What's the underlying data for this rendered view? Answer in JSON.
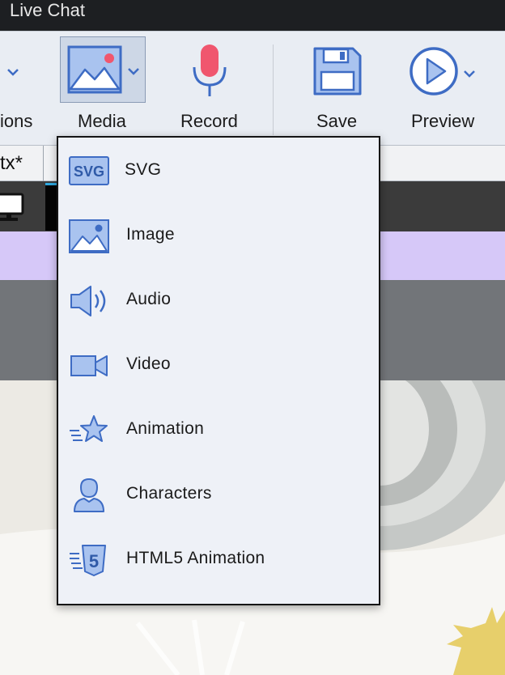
{
  "window": {
    "title": "Live Chat"
  },
  "ribbon": {
    "partial_label": "ions",
    "media_label": "Media",
    "record_label": "Record",
    "save_label": "Save",
    "preview_label": "Preview"
  },
  "tabs": {
    "file_tab": "tx*"
  },
  "media_menu": {
    "items": [
      {
        "label": "SVG",
        "icon": "svg-icon",
        "icon_text": "SVG"
      },
      {
        "label": "Image",
        "icon": "image-icon"
      },
      {
        "label": "Audio",
        "icon": "audio-icon"
      },
      {
        "label": "Video",
        "icon": "video-icon"
      },
      {
        "label": "Animation",
        "icon": "animation-icon"
      },
      {
        "label": "Characters",
        "icon": "characters-icon"
      },
      {
        "label": "HTML5 Animation",
        "icon": "html5-animation-icon",
        "icon_text": "5"
      }
    ]
  },
  "colors": {
    "accent_blue": "#3e6cc4",
    "icon_fill": "#a9c3ef",
    "record_red": "#f0566e",
    "menu_bg": "#eef1f7",
    "title_bg": "#1d1f22"
  }
}
